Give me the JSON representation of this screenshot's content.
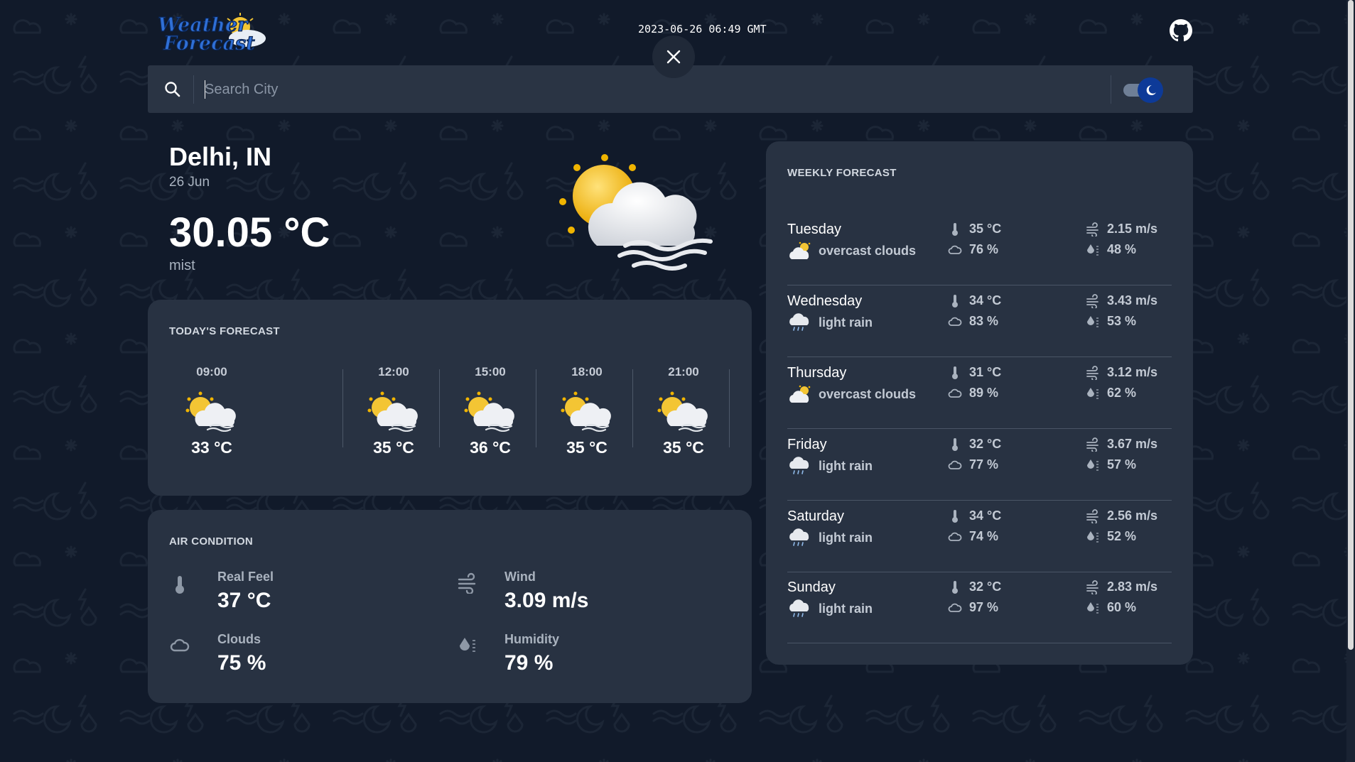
{
  "header": {
    "logo_text_line1": "Weather",
    "logo_text_line2": "Forecast",
    "datetime": "2023-06-26 06:49 GMT"
  },
  "search": {
    "placeholder": "Search City",
    "value": ""
  },
  "theme_toggle": {
    "dark_mode": true
  },
  "current": {
    "city": "Delhi, IN",
    "date": "26 Jun",
    "temperature": "30.05 °C",
    "description": "mist",
    "icon": "sun-cloud-mist-icon"
  },
  "today": {
    "title": "TODAY'S FORECAST",
    "hours": [
      {
        "time": "09:00",
        "temp": "33 °C",
        "icon": "partly-cloudy-icon"
      },
      {
        "time": "12:00",
        "temp": "35 °C",
        "icon": "partly-cloudy-icon"
      },
      {
        "time": "15:00",
        "temp": "36 °C",
        "icon": "partly-cloudy-icon"
      },
      {
        "time": "18:00",
        "temp": "35 °C",
        "icon": "partly-cloudy-icon"
      },
      {
        "time": "21:00",
        "temp": "35 °C",
        "icon": "partly-cloudy-icon"
      }
    ]
  },
  "air": {
    "title": "AIR CONDITION",
    "real_feel": {
      "label": "Real Feel",
      "value": "37 °C"
    },
    "wind": {
      "label": "Wind",
      "value": "3.09 m/s"
    },
    "clouds": {
      "label": "Clouds",
      "value": "75 %"
    },
    "humidity": {
      "label": "Humidity",
      "value": "79 %"
    }
  },
  "weekly": {
    "title": "WEEKLY FORECAST",
    "days": [
      {
        "day": "Tuesday",
        "desc": "overcast clouds",
        "icon": "overcast-icon",
        "temp": "35 °C",
        "clouds": "76 %",
        "wind": "2.15 m/s",
        "humidity": "48 %"
      },
      {
        "day": "Wednesday",
        "desc": "light rain",
        "icon": "rain-icon",
        "temp": "34 °C",
        "clouds": "83 %",
        "wind": "3.43 m/s",
        "humidity": "53 %"
      },
      {
        "day": "Thursday",
        "desc": "overcast clouds",
        "icon": "overcast-icon",
        "temp": "31 °C",
        "clouds": "89 %",
        "wind": "3.12 m/s",
        "humidity": "62 %"
      },
      {
        "day": "Friday",
        "desc": "light rain",
        "icon": "rain-icon",
        "temp": "32 °C",
        "clouds": "77 %",
        "wind": "3.67 m/s",
        "humidity": "57 %"
      },
      {
        "day": "Saturday",
        "desc": "light rain",
        "icon": "rain-icon",
        "temp": "34 °C",
        "clouds": "74 %",
        "wind": "2.56 m/s",
        "humidity": "52 %"
      },
      {
        "day": "Sunday",
        "desc": "light rain",
        "icon": "rain-icon",
        "temp": "32 °C",
        "clouds": "97 %",
        "wind": "2.83 m/s",
        "humidity": "60 %"
      }
    ]
  },
  "colors": {
    "background": "#111a2a",
    "card": "#283242",
    "search_bar": "#2a3444",
    "toggle_knob": "#0d3a98"
  }
}
